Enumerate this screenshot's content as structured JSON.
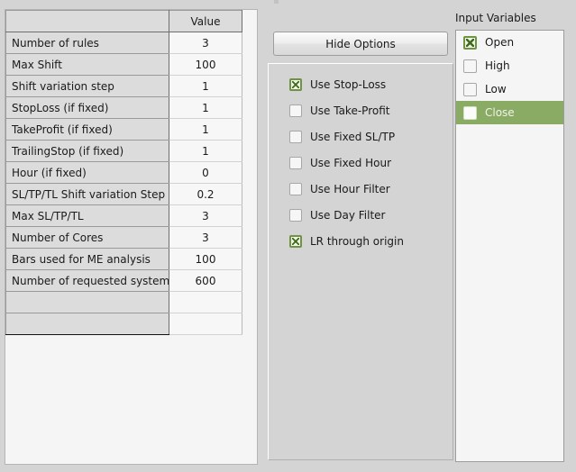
{
  "params_table": {
    "columns": [
      "",
      "Value"
    ],
    "rows": [
      {
        "name": "Number of rules",
        "value": "3"
      },
      {
        "name": "Max Shift",
        "value": "100"
      },
      {
        "name": "Shift variation step",
        "value": "1"
      },
      {
        "name": "StopLoss (if fixed)",
        "value": "1"
      },
      {
        "name": "TakeProfit (if fixed)",
        "value": "1"
      },
      {
        "name": "TrailingStop (if fixed)",
        "value": "1"
      },
      {
        "name": "Hour (if fixed)",
        "value": "0"
      },
      {
        "name": "SL/TP/TL Shift variation Step",
        "value": "0.2"
      },
      {
        "name": "Max SL/TP/TL",
        "value": "3"
      },
      {
        "name": "Number of Cores",
        "value": "3"
      },
      {
        "name": "Bars used for ME analysis",
        "value": "100"
      },
      {
        "name": "Number of requested systems",
        "value": "600"
      },
      {
        "name": "",
        "value": ""
      },
      {
        "name": "",
        "value": ""
      }
    ]
  },
  "options": {
    "hide_options_label": "Hide Options",
    "checkboxes": [
      {
        "label": "Use Stop-Loss",
        "checked": true
      },
      {
        "label": "Use Take-Profit",
        "checked": false
      },
      {
        "label": "Use Fixed SL/TP",
        "checked": false
      },
      {
        "label": "Use Fixed Hour",
        "checked": false
      },
      {
        "label": "Use Hour Filter",
        "checked": false
      },
      {
        "label": "Use Day Filter",
        "checked": false
      },
      {
        "label": "LR through origin",
        "checked": true
      }
    ]
  },
  "input_variables": {
    "title": "Input Variables",
    "items": [
      {
        "label": "Open",
        "checked": true,
        "selected": false
      },
      {
        "label": "High",
        "checked": false,
        "selected": false
      },
      {
        "label": "Low",
        "checked": false,
        "selected": false
      },
      {
        "label": "Close",
        "checked": false,
        "selected": true
      }
    ]
  },
  "colors": {
    "window_background": "#d4d4d4",
    "panel_background": "#f5f5f5",
    "header_cell": "#dcdcdc",
    "selection_green": "#8aab63",
    "checkbox_green": "#6f9244",
    "check_mark": "#3f6b1f"
  }
}
